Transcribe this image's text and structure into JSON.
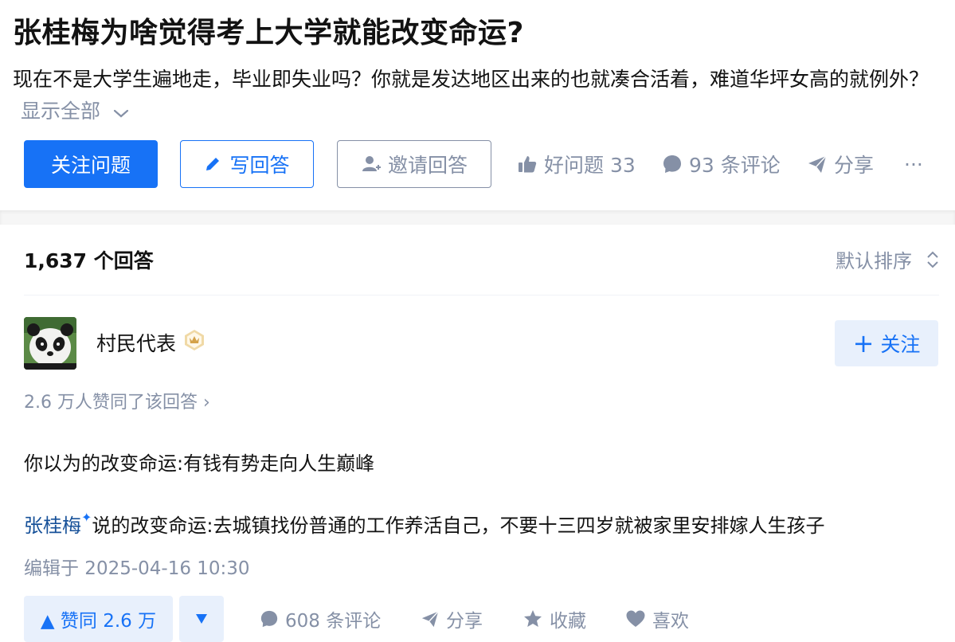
{
  "question": {
    "title": "张桂梅为啥觉得考上大学就能改变命运?",
    "detail": "现在不是大学生遍地走，毕业即失业吗？你就是发达地区出来的也就凑合活着，难道华坪女高的就例外？",
    "show_all": "显示全部"
  },
  "actions": {
    "follow": "关注问题",
    "write": "写回答",
    "invite": "邀请回答",
    "good_question": "好问题 33",
    "comments": "93 条评论",
    "share": "分享",
    "more": "···"
  },
  "answers": {
    "count": "1,637 个回答",
    "sort": "默认排序"
  },
  "answer": {
    "author": "村民代表",
    "follow": "关注",
    "follow_plus": "+",
    "voters": "2.6 万人赞同了该回答 ›",
    "para1": "你以为的改变命运:有钱有势走向人生巅峰",
    "mention": "张桂梅",
    "para2": "说的改变命运:去城镇找份普通的工作养活自己，不要十三四岁就被家里安排嫁人生孩子",
    "edited": "编辑于 2025-04-16 10:30",
    "upvote": "▲ 赞同 2.6 万",
    "comments": "608 条评论",
    "share": "分享",
    "collect": "收藏",
    "like": "喜欢"
  },
  "colors": {
    "brand": "#1772f6",
    "muted": "#8590a6",
    "link": "#175199",
    "light_blue_bg": "#e8f0fc"
  }
}
